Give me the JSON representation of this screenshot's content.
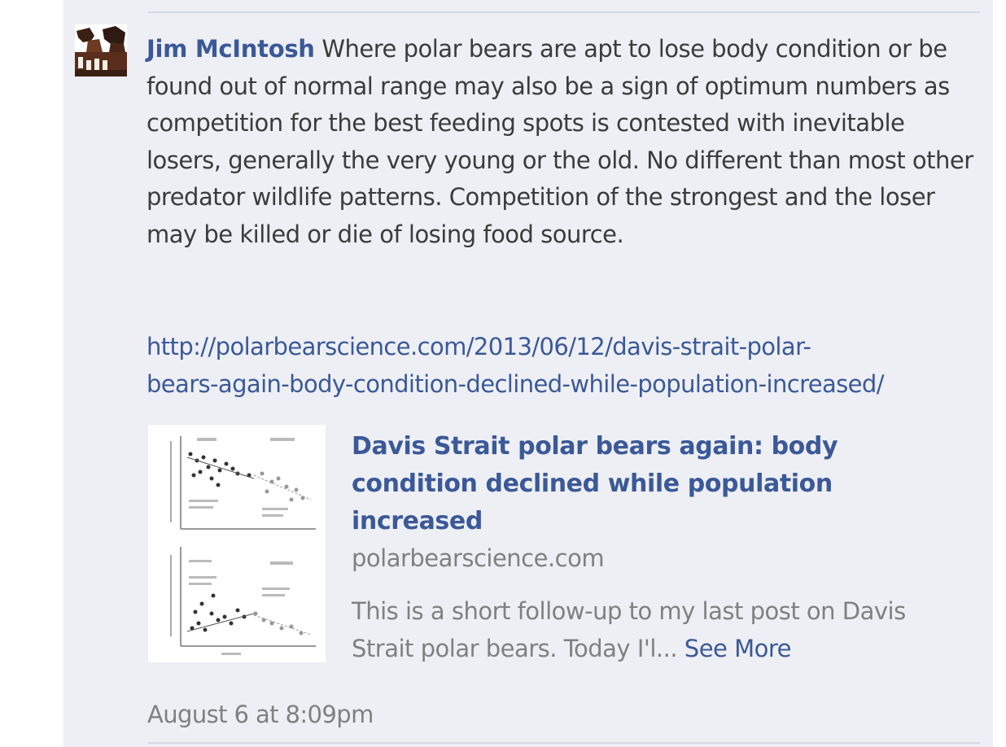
{
  "comment": {
    "author": "Jim McIntosh",
    "text": "Where polar bears are apt to lose body condition or be found out of normal range may also be a sign of optimum numbers as competition for the best feeding spots is contested with inevitable losers, generally the very young or the old. No different than most other predator wildlife patterns. Competition of the strongest and the loser may be killed or die of losing food source.",
    "link_lines": [
      "http://polarbearscience.com/2013/06/12/davis-strait-polar-",
      "bears-again-body-condition-declined-while-population-increased/"
    ],
    "timestamp": "August 6 at 8:09pm"
  },
  "preview": {
    "title_lines": [
      "Davis Strait polar bears again: body",
      "condition declined while population",
      "increased"
    ],
    "domain": "polarbearscience.com",
    "desc_lines": [
      "This is a short follow-up to my last post on Davis",
      "Strait polar bears. Today I'l..."
    ],
    "see_more": "See More"
  },
  "colors": {
    "link": "#3b5998",
    "panel_bg": "#edeff4",
    "muted": "#808080"
  },
  "icons": {
    "avatar": "user-avatar-icon",
    "thumbnail": "scatter-chart-thumbnail"
  }
}
